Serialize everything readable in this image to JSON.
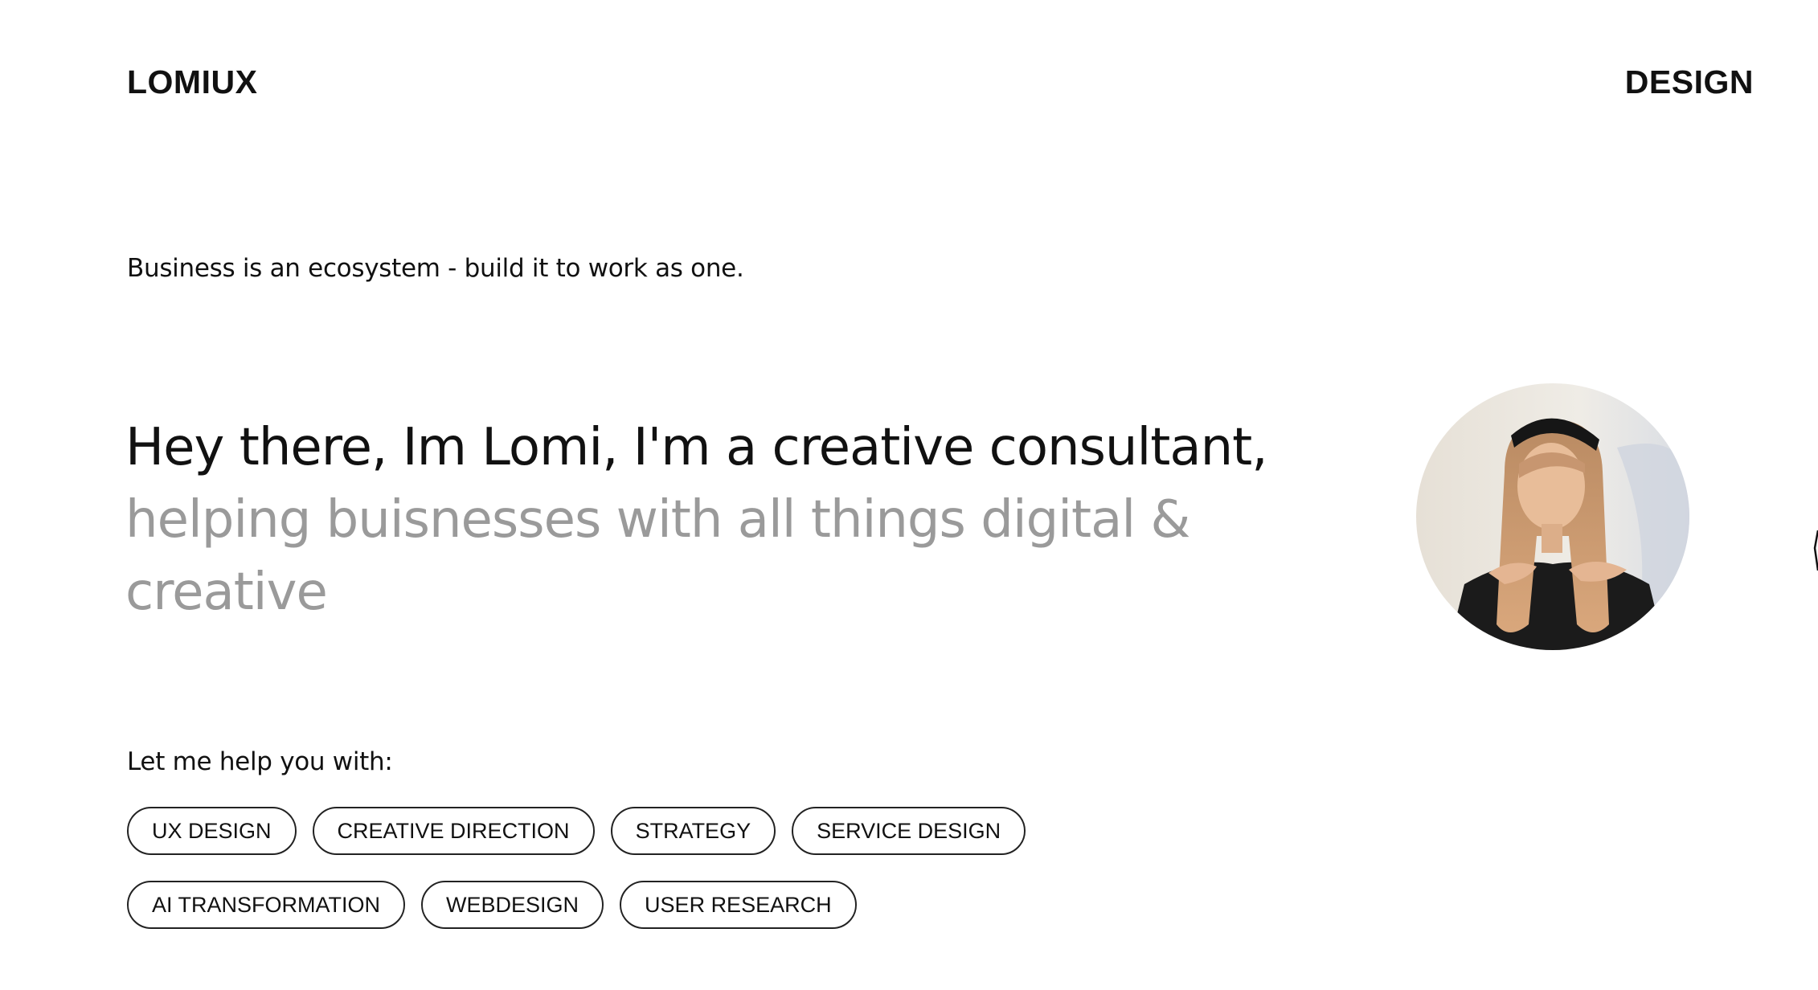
{
  "header": {
    "logo": "LOMIUX",
    "nav_link": "DESIGN"
  },
  "intro": {
    "tagline": "Business is an ecosystem - build it to work as one."
  },
  "hero": {
    "line_dark": "Hey there, Im Lomi, I'm a creative consultant,",
    "line_grey": "helping buisnesses with all things digital & creative"
  },
  "services": {
    "label": "Let me help you with:",
    "row_1": [
      "UX DESIGN",
      "CREATIVE DIRECTION",
      "STRATEGY",
      "SERVICE DESIGN"
    ],
    "row_2": [
      "AI TRANSFORMATION",
      "WEBDESIGN",
      "USER RESEARCH"
    ]
  },
  "colors": {
    "text_primary": "#111111",
    "text_muted": "#9a9a9a",
    "background": "#ffffff",
    "chip_border": "#222222"
  },
  "icons": {
    "avatar": "portrait-photo"
  }
}
